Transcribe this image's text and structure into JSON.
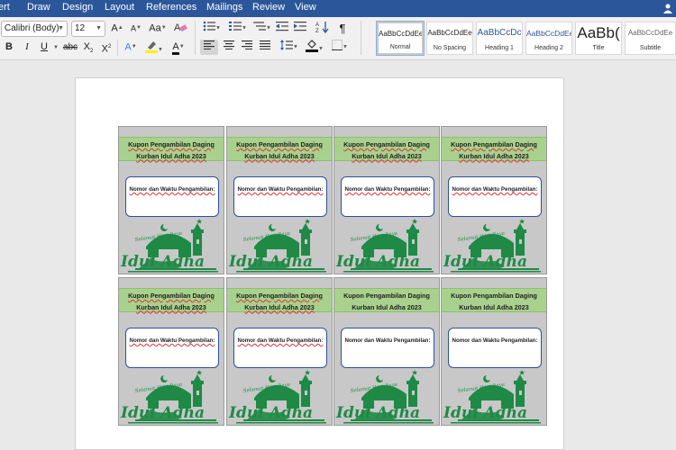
{
  "ribbon_tabs": [
    "ert",
    "Draw",
    "Design",
    "Layout",
    "References",
    "Mailings",
    "Review",
    "View"
  ],
  "font": {
    "name": "Calibri (Body)",
    "size": "12"
  },
  "toolbar": {
    "grow_label": "A",
    "shrink_label": "A",
    "case_label": "Aa",
    "bold": "B",
    "italic": "I",
    "underline": "U",
    "strikethrough": "abc",
    "subscript": "X",
    "superscript": "X",
    "text_effects": "A",
    "font_color": "A",
    "sort_label": "A",
    "pilcrow": "¶"
  },
  "styles": [
    {
      "sample": "AaBbCcDdEe",
      "name": "Normal"
    },
    {
      "sample": "AaBbCcDdEe",
      "name": "No Spacing"
    },
    {
      "sample": "AaBbCcDc",
      "name": "Heading 1"
    },
    {
      "sample": "AaBbCcDdEe",
      "name": "Heading 2"
    },
    {
      "sample": "AaBb(",
      "name": "Title"
    },
    {
      "sample": "AaBbCcDdEe",
      "name": "Subtitle"
    }
  ],
  "coupon": {
    "title_line1": "Kupon Pengambilan Daging",
    "title_line2": "Kurban Idul Adha 2023",
    "label": "Nomor dan Waktu Pengambilan:",
    "logo_script": "Selamat Hari Raya",
    "logo_text": "Idul Adha"
  },
  "colors": {
    "ribbon_blue": "#2b579a",
    "header_green": "#a9d18e",
    "logo_green": "#1e8a45",
    "coupon_gray": "#c8c8c8"
  }
}
